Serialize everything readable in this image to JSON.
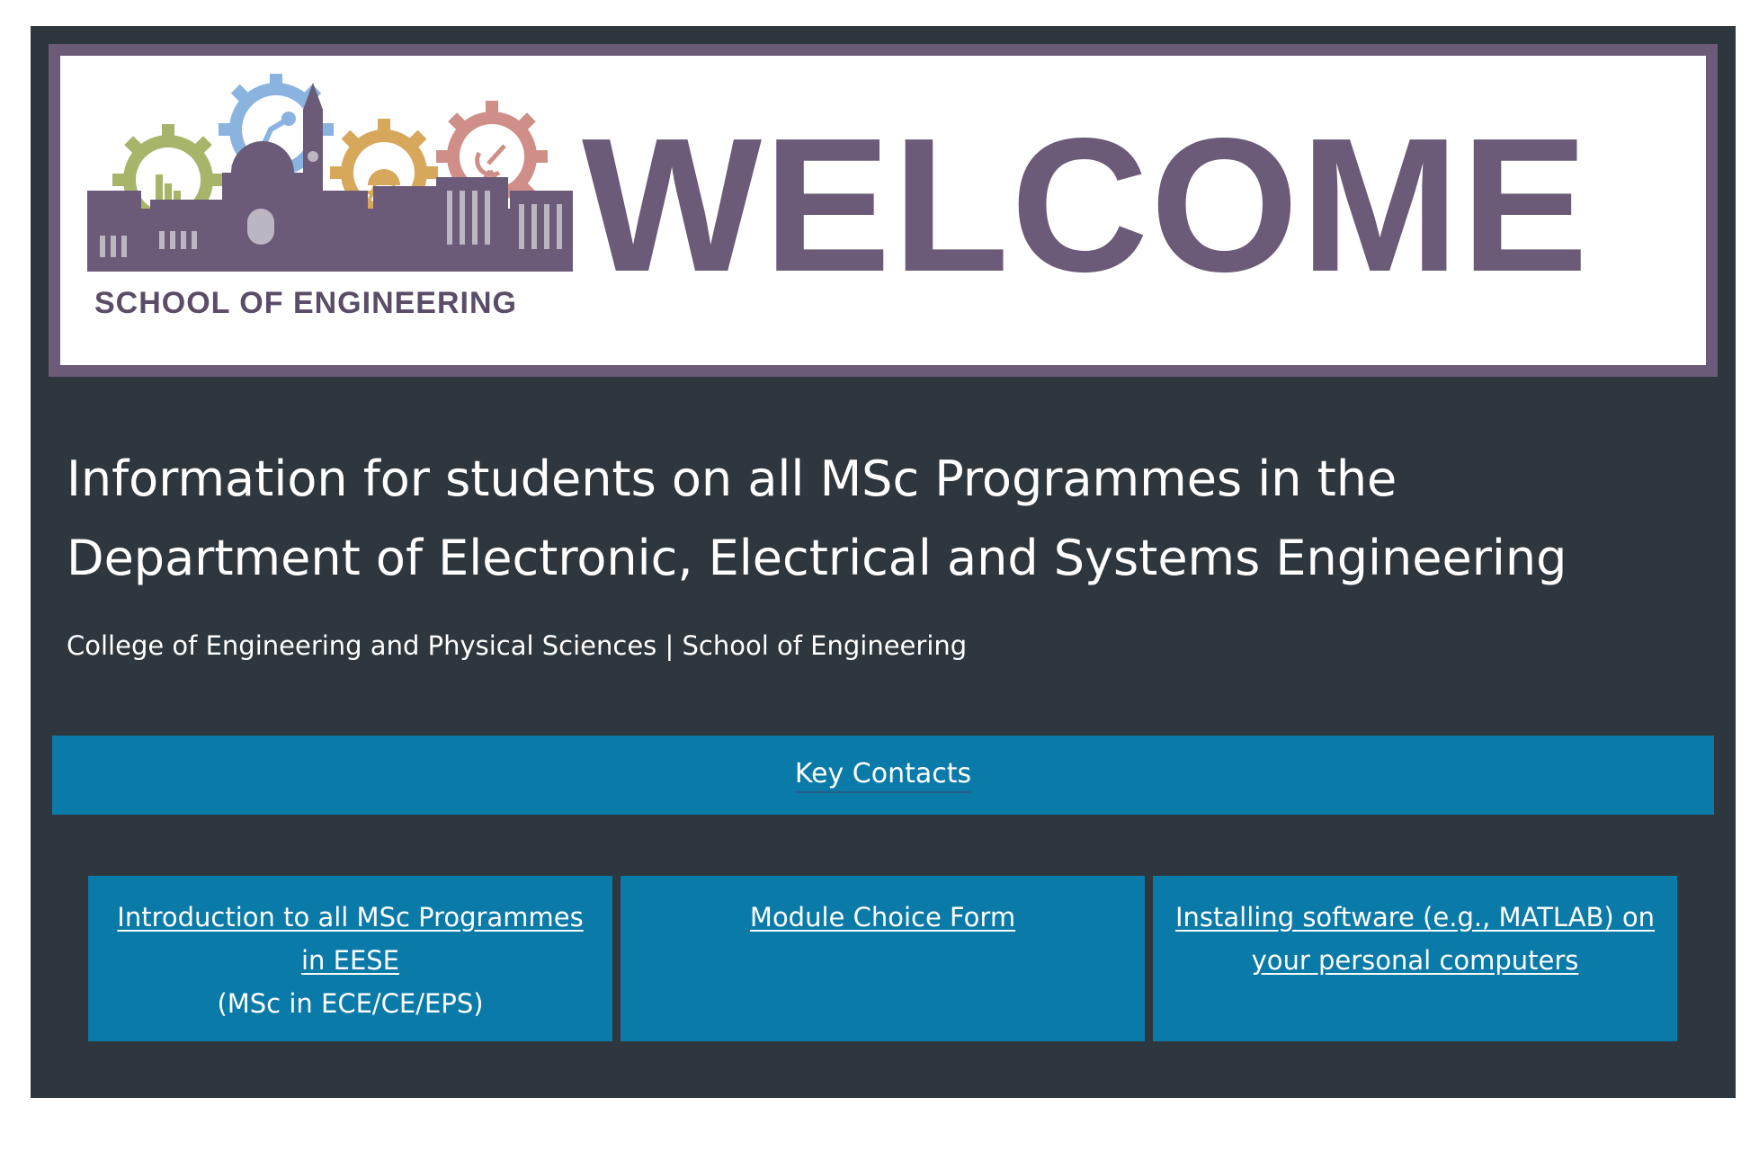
{
  "banner": {
    "logo_caption": "SCHOOL OF ENGINEERING",
    "welcome_text": "WELCOME",
    "colors": {
      "frame": "#6b5b78",
      "gear_green": "#a7b56a",
      "gear_blue": "#8bb3df",
      "gear_gold": "#d7a85b",
      "gear_red": "#cf8f88",
      "building": "#6b5b78"
    }
  },
  "header": {
    "title": "Information for students on all MSc Programmes in the Department of Electronic, Electrical and Systems Engineering",
    "subtitle": "College of Engineering and Physical Sciences | School of Engineering"
  },
  "key_contacts": {
    "label": "Key Contacts"
  },
  "cards": [
    {
      "link_label": "Introduction to all MSc Programmes in EESE",
      "note": "(MSc in ECE/CE/EPS)"
    },
    {
      "link_label": "Module Choice Form"
    },
    {
      "link_label": "Installing software (e.g., MATLAB) on your personal computers"
    }
  ],
  "colors": {
    "panel_background": "#2e373e",
    "button_background": "#0a7aa8",
    "text": "#ffffff"
  }
}
